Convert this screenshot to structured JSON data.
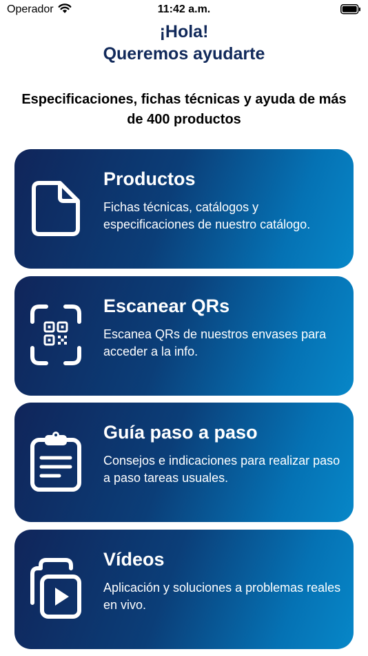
{
  "status_bar": {
    "carrier": "Operador",
    "time": "11:42 a.m."
  },
  "header": {
    "greeting": "¡Hola!",
    "headline": "Queremos ayudarte",
    "subtitle": "Especificaciones, fichas técnicas y ayuda de más de 400 productos"
  },
  "cards": [
    {
      "title": "Productos",
      "description": "Fichas técnicas, catálogos y especificaciones de nuestro catálogo.",
      "icon": "document-icon"
    },
    {
      "title": "Escanear QRs",
      "description": "Escanea QRs de nuestros envases para acceder a la info.",
      "icon": "qr-scan-icon"
    },
    {
      "title": "Guía paso a paso",
      "description": "Consejos e indicaciones para realizar paso a paso tareas usuales.",
      "icon": "clipboard-icon"
    },
    {
      "title": "Vídeos",
      "description": "Aplicación y soluciones a problemas reales en vivo.",
      "icon": "video-play-icon"
    }
  ],
  "colors": {
    "heading": "#11295a",
    "card_gradient_start": "#10255a",
    "card_gradient_end": "#0787c8",
    "card_text": "#ffffff"
  }
}
